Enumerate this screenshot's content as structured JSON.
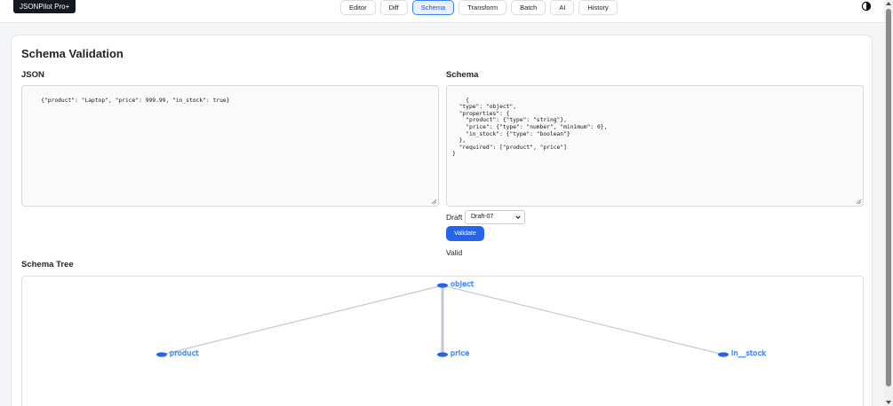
{
  "app": {
    "brand": "JSONPilot Pro+"
  },
  "nav": {
    "tabs": [
      {
        "label": "Editor"
      },
      {
        "label": "Diff"
      },
      {
        "label": "Schema",
        "active": true
      },
      {
        "label": "Transform"
      },
      {
        "label": "Batch"
      },
      {
        "label": "AI"
      },
      {
        "label": "History"
      }
    ],
    "theme_toggle_icon": "contrast-icon"
  },
  "page": {
    "title": "Schema Validation",
    "json_label": "JSON",
    "json_value": "{\"product\": \"Laptop\", \"price\": 999.99, \"in_stock\": true}",
    "schema_label": "Schema",
    "schema_value": "{\n  \"type\": \"object\",\n  \"properties\": {\n    \"product\": {\"type\": \"string\"},\n    \"price\": {\"type\": \"number\", \"minimum\": 0},\n    \"in_stock\": {\"type\": \"boolean\"}\n  },\n  \"required\": [\"product\", \"price\"]\n}",
    "draft_label": "Draft",
    "draft_selected": "Draft-07",
    "validate_label": "Validate",
    "status": "Valid",
    "tree_label": "Schema Tree"
  },
  "tree": {
    "root": "object",
    "children": [
      "product",
      "price",
      "in__stock"
    ],
    "node_color": "#2563eb",
    "edge_color": "#c4c6d6"
  },
  "colors": {
    "accent": "#2563eb",
    "brand_bg": "#14181f"
  }
}
